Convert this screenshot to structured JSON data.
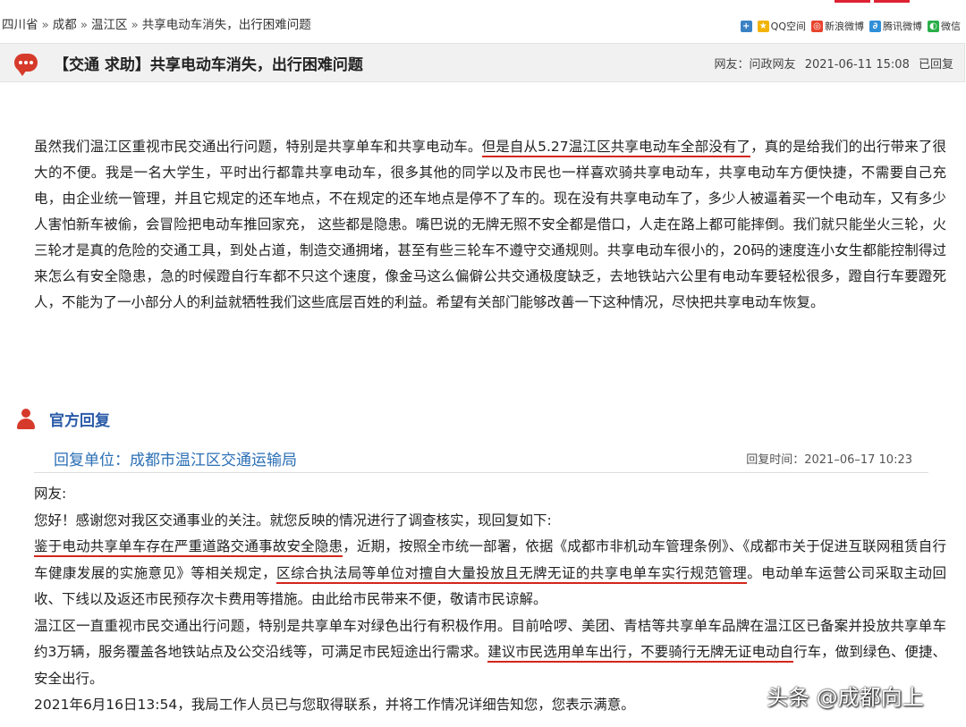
{
  "breadcrumb": {
    "province": "四川省",
    "city": "成都",
    "district": "温江区",
    "current": "共享电动车消失，出行困难问题",
    "separator": "»"
  },
  "share": {
    "qq": "QQ空间",
    "sina": "新浪微博",
    "tencent": "腾讯微博",
    "wechat": "微信"
  },
  "post": {
    "title": "【交通 求助】共享电动车消失，出行困难问题",
    "author_label": "网友：问政网友",
    "date": "2021-06-11 15:08",
    "status": "已回复",
    "body_1": "虽然我们温江区重视市民交通出行问题，特别是共享单车和共享电动车。",
    "body_hl": "但是自从5.27温江区共享电动车全部没有了",
    "body_2": "，真的是给我们的出行带来了很大的不便。我是一名大学生，平时出行都靠共享电动车，很多其他的同学以及市民也一样喜欢骑共享电动车，共享电动车方便快捷，不需要自己充电，由企业统一管理，并且它规定的还车地点，不在规定的还车地点是停不了车的。现在没有共享电动车了，多少人被逼着买一个电动车，又有多少人害怕新车被偷，会冒险把电动车推回家充， 这些都是隐患。嘴巴说的无牌无照不安全都是借口，人走在路上都可能摔倒。我们就只能坐火三轮，火三轮才是真的危险的交通工具，到处占道，制造交通拥堵，甚至有些三轮车不遵守交通规则。共享电动车很小的，20码的速度连小女生都能控制得过来怎么有安全隐患，急的时候蹬自行车都不只这个速度，像金马这么偏僻公共交通极度缺乏，去地铁站六公里有电动车要轻松很多，蹬自行车要蹬死人，不能为了一小部分人的利益就牺牲我们这些底层百姓的利益。希望有关部门能够改善一下这种情况，尽快把共享电动车恢复。"
  },
  "reply": {
    "section_title": "官方回复",
    "unit": "回复单位：成都市温江区交通运输局",
    "time_label": "回复时间：",
    "time": "2021–06–17 10:23",
    "greeting": "网友:",
    "line1": "您好！感谢您对我区交通事业的关注。就您反映的情况进行了调查核实，现回复如下:",
    "p2_hl1": "鉴于电动共享单车存在严重道路交通事故安全隐患",
    "p2_a": "，近期，按照全市统一部署，依据《成都市非机动车管理条例》、《成都市关于促进互联网租赁自行车健康发展的实施意见》等相关规定，",
    "p2_hl2": "区综合执法局等单位对擅自大量投放且无牌无证的共享电单车实行规范管理",
    "p2_b": "。电动单车运营公司采取主动回收、下线以及返还市民预存次卡费用等措施。由此给市民带来不便，敬请市民谅解。",
    "p3_a": "温江区一直重视市民交通出行问题，特别是共享单车对绿色出行有积极作用。目前哈啰、美团、青桔等共享单车品牌在温江区已备案并投放共享单车约3万辆，服务覆盖各地铁站点及公交沿线等，可满足市民短途出行需求。",
    "p3_hl": "建议市民选用单车出行，不要骑行无牌无证电动自",
    "p3_b": "行车，做到绿色、便捷、安全出行。",
    "p4": "2021年6月16日13:54，我局工作人员已与您取得联系，并将工作情况详细告知您，您表示满意。"
  },
  "watermark": "头条 @成都向上",
  "colors": {
    "accent_red": "#d3261c",
    "link_blue": "#2a6fb5",
    "title_bg": "#f1f1f1"
  }
}
